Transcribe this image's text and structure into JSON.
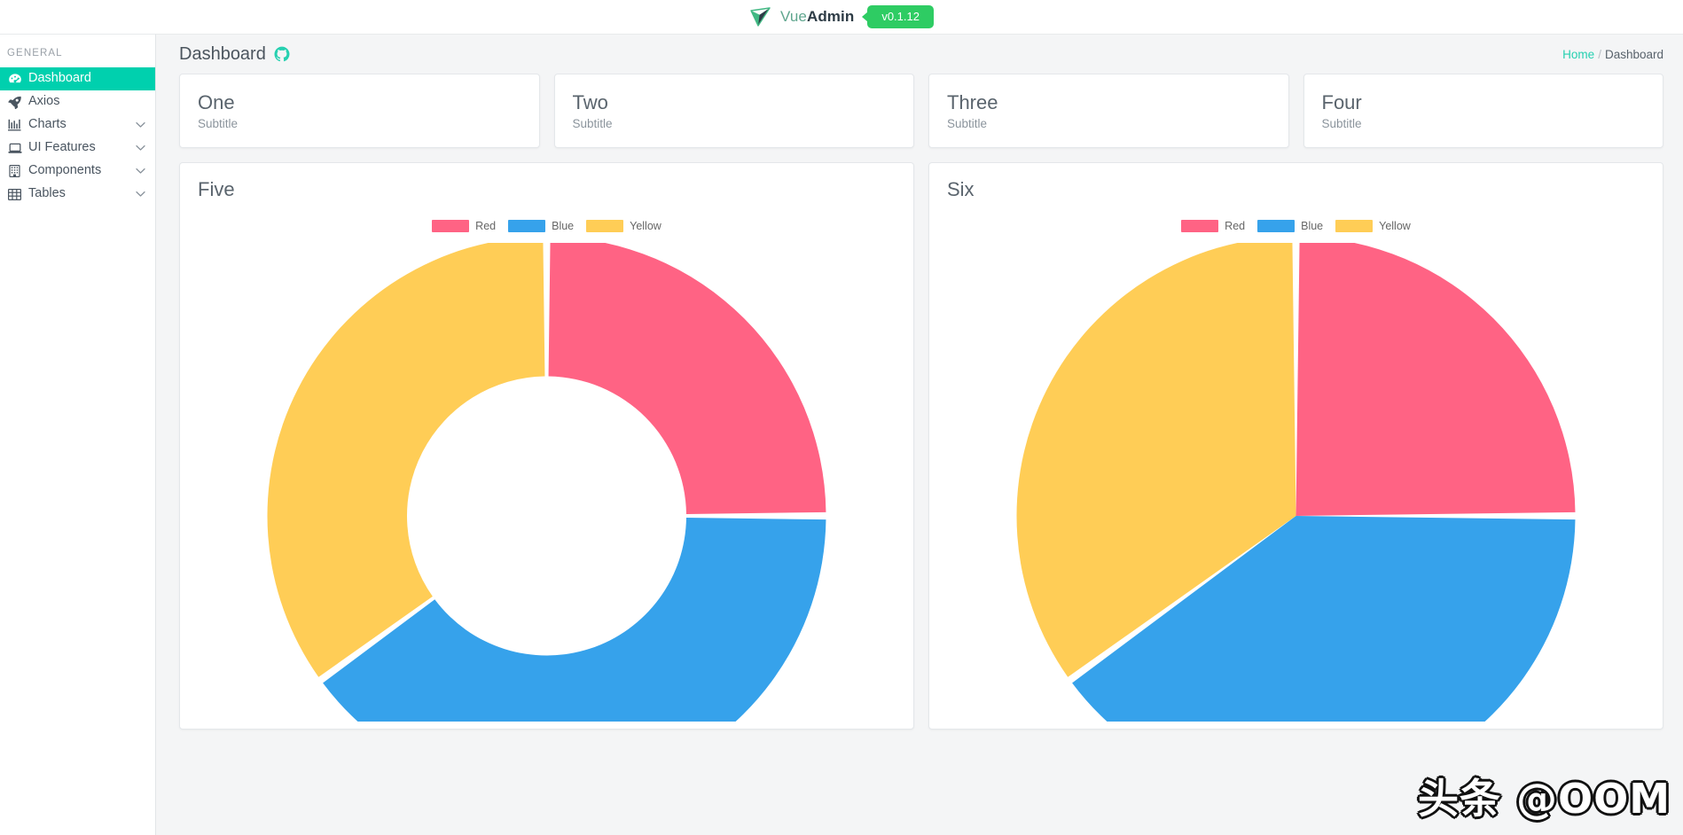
{
  "brand": {
    "logo_icon": "vue-paper-plane-logo",
    "name_prefix": "Vue",
    "name_suffix": "Admin",
    "version": "v0.1.12",
    "badge_color": "#2ecc63",
    "accent_color": "#00d0ae"
  },
  "sidebar": {
    "heading": "GENERAL",
    "items": [
      {
        "label": "Dashboard",
        "icon": "speedometer-icon",
        "active": true,
        "expandable": false
      },
      {
        "label": "Axios",
        "icon": "rocket-icon",
        "active": false,
        "expandable": false
      },
      {
        "label": "Charts",
        "icon": "bar-chart-icon",
        "active": false,
        "expandable": true
      },
      {
        "label": "UI Features",
        "icon": "laptop-icon",
        "active": false,
        "expandable": true
      },
      {
        "label": "Components",
        "icon": "building-icon",
        "active": false,
        "expandable": true
      },
      {
        "label": "Tables",
        "icon": "table-grid-icon",
        "active": false,
        "expandable": true
      }
    ]
  },
  "page": {
    "title": "Dashboard",
    "title_icon": "github-icon",
    "breadcrumb": {
      "home": "Home",
      "separator": "/",
      "current": "Dashboard"
    }
  },
  "stat_cards": [
    {
      "title": "One",
      "subtitle": "Subtitle"
    },
    {
      "title": "Two",
      "subtitle": "Subtitle"
    },
    {
      "title": "Three",
      "subtitle": "Subtitle"
    },
    {
      "title": "Four",
      "subtitle": "Subtitle"
    }
  ],
  "chart_cards": [
    {
      "title": "Five"
    },
    {
      "title": "Six"
    }
  ],
  "watermark": "头条 @OOM",
  "chart_data": [
    {
      "type": "pie",
      "variant": "doughnut",
      "title": "Five",
      "labels": [
        "Red",
        "Blue",
        "Yellow"
      ],
      "values": [
        25,
        40,
        35
      ],
      "colors": [
        "#ff6384",
        "#36a2eb",
        "#ffcd56"
      ],
      "legend_position": "top",
      "start_angle_deg": 0,
      "cutout_percent": 50,
      "slice_gap_deg": 1.5,
      "grid": false,
      "xlabel": "",
      "ylabel": ""
    },
    {
      "type": "pie",
      "variant": "pie",
      "title": "Six",
      "labels": [
        "Red",
        "Blue",
        "Yellow"
      ],
      "values": [
        25,
        40,
        35
      ],
      "colors": [
        "#ff6384",
        "#36a2eb",
        "#ffcd56"
      ],
      "legend_position": "top",
      "start_angle_deg": 0,
      "cutout_percent": 0,
      "slice_gap_deg": 1.5,
      "grid": false,
      "xlabel": "",
      "ylabel": ""
    }
  ]
}
